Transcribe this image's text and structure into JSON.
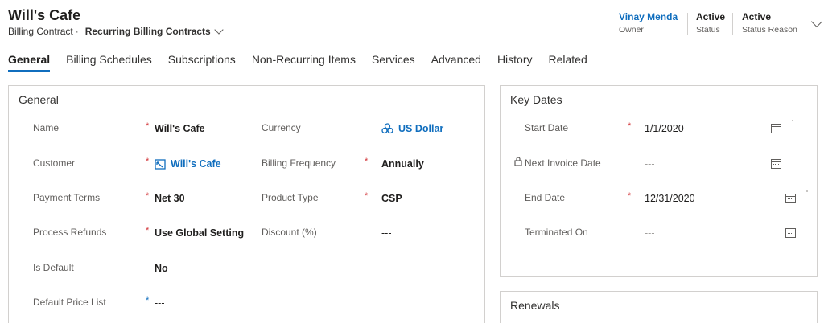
{
  "header": {
    "title": "Will's Cafe",
    "entity": "Billing Contract",
    "separator": "·",
    "view": "Recurring Billing Contracts",
    "fields": [
      {
        "value": "Vinay Menda",
        "label": "Owner"
      },
      {
        "value": "Active",
        "label": "Status"
      },
      {
        "value": "Active",
        "label": "Status Reason"
      }
    ]
  },
  "tabs": [
    "General",
    "Billing Schedules",
    "Subscriptions",
    "Non-Recurring Items",
    "Services",
    "Advanced",
    "History",
    "Related"
  ],
  "general": {
    "title": "General",
    "left": [
      {
        "label": "Name",
        "value": "Will's Cafe",
        "req": "*"
      },
      {
        "label": "Customer",
        "value": "Will's Cafe",
        "req": "*"
      },
      {
        "label": "Payment Terms",
        "value": "Net 30",
        "req": "*"
      },
      {
        "label": "Process Refunds",
        "value": "Use Global Setting",
        "req": "*"
      },
      {
        "label": "Is Default",
        "value": "No"
      },
      {
        "label": "Default Price List",
        "value": "---",
        "req": "*"
      }
    ],
    "right": [
      {
        "label": "Currency",
        "value": "US Dollar"
      },
      {
        "label": "Billing Frequency",
        "value": "Annually",
        "req": "*"
      },
      {
        "label": "Product Type",
        "value": "CSP",
        "req": "*"
      },
      {
        "label": "Discount (%)",
        "value": "---"
      }
    ]
  },
  "key_dates": {
    "title": "Key Dates",
    "rows": [
      {
        "label": "Start Date",
        "value": "1/1/2020",
        "req": "*"
      },
      {
        "label": "Next Invoice Date",
        "value": "---"
      },
      {
        "label": "End Date",
        "value": "12/31/2020",
        "req": "*"
      },
      {
        "label": "Terminated On",
        "value": "---"
      }
    ]
  },
  "renewals": {
    "title": "Renewals"
  },
  "colors": {
    "accent": "#106ebe",
    "required": "#d13438",
    "border": "#d2d0ce"
  }
}
